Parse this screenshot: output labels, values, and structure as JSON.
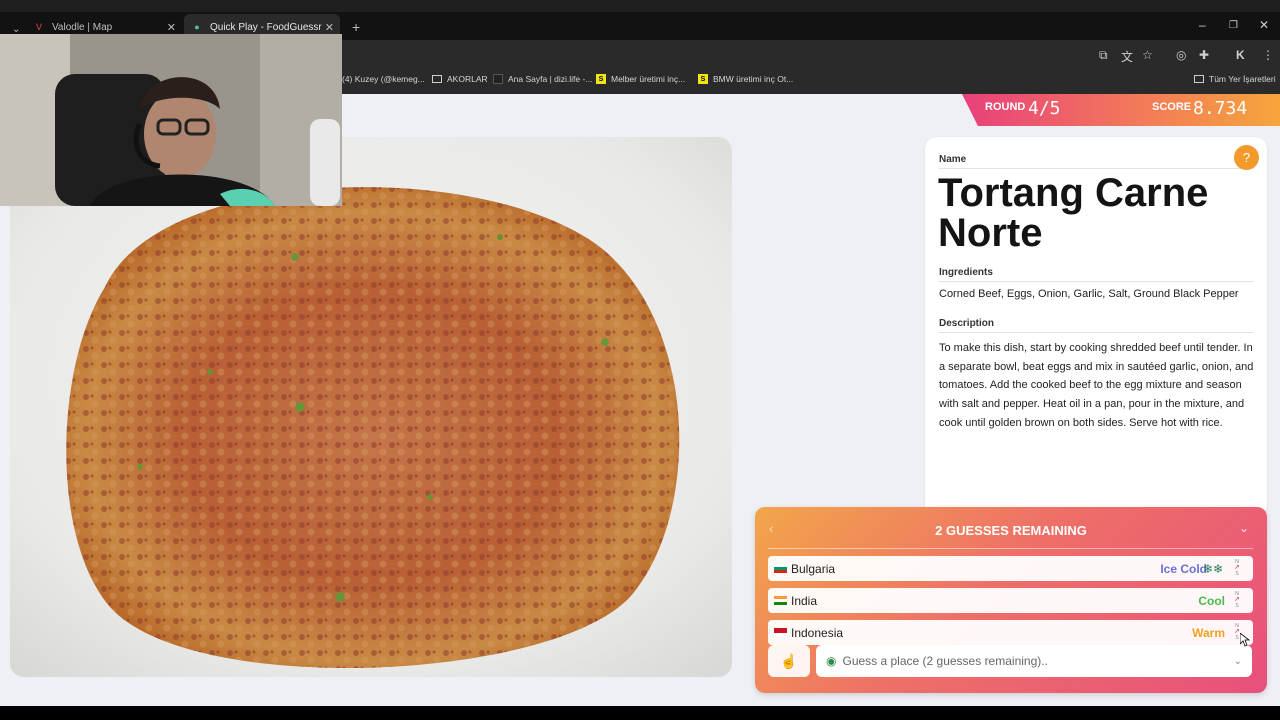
{
  "browser": {
    "tabs": [
      {
        "title": "Valodle | Map",
        "active": false
      },
      {
        "title": "Quick Play - FoodGuessr | Food",
        "active": true
      }
    ],
    "bookmarks": [
      "(4) Kuzey (@kemeg...",
      "AKORLAR",
      "Ana Sayfa | dizi.life -...",
      "Melber üretimi inç...",
      "BMW üretimi inç Ot...",
      "Tüm Yer İşaretleri"
    ]
  },
  "hud": {
    "round_label": "ROUND",
    "round_value": "4/5",
    "score_label": "SCORE",
    "score_value": "8.734"
  },
  "dish": {
    "name_label": "Name",
    "name": "Tortang Carne Norte",
    "ingredients_label": "Ingredients",
    "ingredients": "Corned Beef, Eggs, Onion, Garlic, Salt, Ground Black Pepper",
    "description_label": "Description",
    "description": "To make this dish, start by cooking shredded beef until tender. In a separate bowl, beat eggs and mix in sautéed garlic, onion, and tomatoes. Add the cooked beef to the egg mixture and season with salt and pepper. Heat oil in a pan, pour in the mixture, and cook until golden brown on both sides. Serve hot with rice."
  },
  "guesses": {
    "title": "2 GUESSES REMAINING",
    "items": [
      {
        "country": "Bulgaria",
        "temperature": "Ice Cold",
        "color": "#6b6fd6",
        "extra": "❄❄"
      },
      {
        "country": "India",
        "temperature": "Cool",
        "color": "#4fb84a",
        "extra": ""
      },
      {
        "country": "Indonesia",
        "temperature": "Warm",
        "color": "#f0a020",
        "extra": ""
      }
    ],
    "input_placeholder": "Guess a place (2 guesses remaining).."
  },
  "colors": {
    "accent_pink": "#e8507c",
    "accent_orange": "#f2a64a"
  }
}
